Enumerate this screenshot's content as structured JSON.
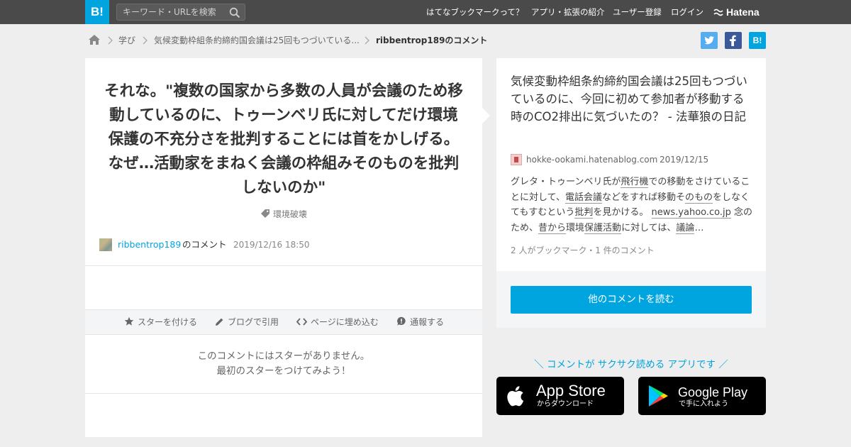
{
  "header": {
    "logo": "B!",
    "search_placeholder": "キーワード・URLを検索",
    "nav": [
      "はてなブックマークって？",
      "アプリ・拡張の紹介",
      "ユーザー登録",
      "ログイン"
    ],
    "brand": "Hatena"
  },
  "breadcrumb": {
    "items": [
      "学び",
      "気候変動枠組条約締約国会議は25回もつづいている...",
      "ribbentrop189のコメント"
    ]
  },
  "share": {
    "hatena_label": "B!"
  },
  "comment": {
    "text": "それな。\"複数の国家から多数の人員が会議のため移動しているのに、トゥーンベリ氏に対してだけ環境保護の不充分さを批判することには首をかしげる。なぜ…活動家をまねく会議の枠組みそのものを批判しないのか\"",
    "tag": "環境破壊",
    "author": "ribbentrop189",
    "author_suffix": "のコメント",
    "date": "2019/12/16 18:50"
  },
  "actions": {
    "star": "スターを付ける",
    "blog": "ブログで引用",
    "embed": "ページに埋め込む",
    "report": "通報する"
  },
  "no_star": {
    "line1": "このコメントにはスターがありません。",
    "line2": "最初のスターをつけてみよう！"
  },
  "entry": {
    "title": "気候変動枠組条約締約国会議は25回もつづいているのに、今回に初めて参加者が移動する時のCO2排出に気づいたの？ - 法華狼の日記",
    "domain": "hokke-ookami.hatenablog.com",
    "date": "2019/12/15",
    "desc": {
      "p1": "グレタ・トゥーンベリ氏が",
      "k1": "飛行機",
      "p2": "での移動をさけていることに対して、",
      "k2": "電話会議",
      "p3": "などをすれば移動そ",
      "k3": "のもの",
      "p4": "をしなくてもすむという",
      "k4": "批判",
      "p5": "を見かける。 ",
      "k5": "news.yahoo.co.jp",
      "p6": " 念のため、",
      "k6": "昔から",
      "p7": "環境",
      "k7": "保護活動",
      "p8": "に対しては、",
      "k8": "議論",
      "p9": "…"
    },
    "count": "2 人がブックマーク・1 件のコメント",
    "read_button": "他のコメントを読む"
  },
  "app": {
    "catch": "＼ コメントが サクサク読める アプリです ／",
    "apple_name": "App Store",
    "apple_sub": "からダウンロード",
    "google_name": "Google Play",
    "google_sub": "で手に入れよう"
  },
  "colors": {
    "accent": "#00a4de",
    "topbar": "#4a4a4a",
    "background": "#eeeeee",
    "twitter": "#55acee",
    "facebook": "#3b5998"
  }
}
